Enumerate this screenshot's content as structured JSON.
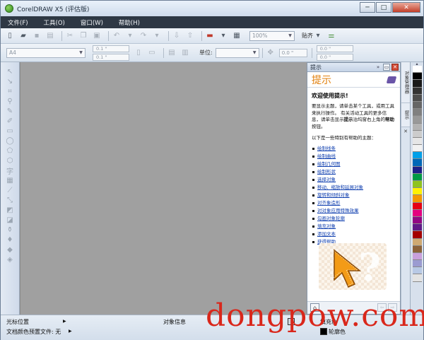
{
  "window": {
    "title": "CorelDRAW X5 (评估版)",
    "controls": [
      "─",
      "□",
      "✕"
    ]
  },
  "menu": [
    "文件(F)",
    "工具(O)",
    "窗口(W)",
    "帮助(H)"
  ],
  "toolbar": {
    "zoom_value": "100%",
    "snap_label": "贴齐"
  },
  "property_bar": {
    "page_size": "A4",
    "width": "0.1 \"",
    "height": "0.1 \"",
    "unit_label": "单位:",
    "nudge": "0.0 \"",
    "dup_x": "0.0 \"",
    "dup_y": "0.0 \""
  },
  "docker": {
    "header": "提示",
    "title": "提示",
    "welcome": "欢迎使用提示!",
    "intro_1": "要显示主题，请单击某个工具，或用工具来执行操作。 有关活动工具的更多信息，请单击显示",
    "intro_bold_1": "提示",
    "intro_2": "泊坞窗右上角的",
    "intro_bold_2": "帮助",
    "intro_3": "按钮。",
    "topics_head": "以下是一些特别有帮助的主题：",
    "topics": [
      "绘制线条",
      "绘制曲线",
      "绘制几何图",
      "绘制形状",
      "选择对象",
      "移动、缩放和延展对象",
      "旋转和倾斜对象",
      "对齐象造形",
      "对对象应用特殊效果",
      "勾画对象轮廓",
      "填充对象",
      "添加文本",
      "获得帮助"
    ],
    "art_symbol": "?"
  },
  "side_tabs": [
    "对象管理器",
    "提示"
  ],
  "palette_colors": [
    "#ffffff",
    "#000000",
    "#1a1a1a",
    "#333333",
    "#4d4d4d",
    "#666666",
    "#808080",
    "#999999",
    "#b3b3b3",
    "#cccccc",
    "#e6e6e6",
    "#f2f2f2",
    "#00a0e9",
    "#0068b7",
    "#1d2088",
    "#009944",
    "#8fc31f",
    "#fff100",
    "#f39800",
    "#e60012",
    "#e4007f",
    "#920783",
    "#601986",
    "#a40000",
    "#cfa972",
    "#8c6239",
    "#c9a0dc",
    "#9b9bd1",
    "#b8c9e5",
    "#e3e3e3"
  ],
  "status": {
    "cursor_position": "光标位置",
    "object_info": "对象信息",
    "doc_color": "文档颜色预置文件: 无",
    "fill_label": "填充色",
    "outline_label": "轮廓色"
  },
  "watermark": "dongpow.com"
}
